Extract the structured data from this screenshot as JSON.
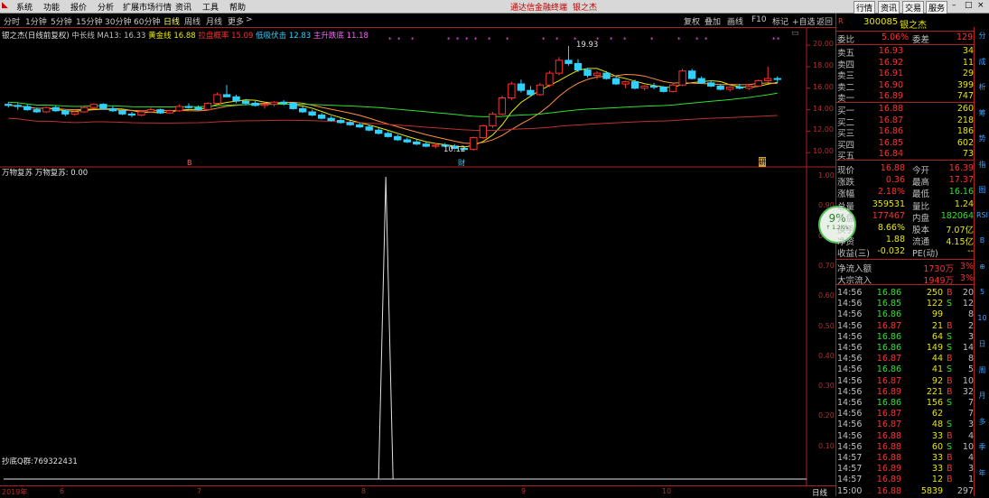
{
  "menu": [
    "系统",
    "功能",
    "报价",
    "分析",
    "扩展市场行情",
    "资讯",
    "工具",
    "帮助"
  ],
  "title_center": "通达信金融终端",
  "title_stock": "银之杰",
  "top_right_buttons": [
    "行情",
    "资讯",
    "交易",
    "服务"
  ],
  "toolbar": {
    "periods": [
      "分时",
      "1分钟",
      "5分钟",
      "15分钟",
      "30分钟",
      "60分钟",
      "日线",
      "周线",
      "月线",
      "更多",
      ">"
    ],
    "right_buttons": [
      "复权",
      "叠加",
      "画线",
      "F10",
      "标记",
      "+自选",
      "返回"
    ]
  },
  "chart_header": {
    "name": "银之杰(日线前复权)",
    "items": [
      {
        "label": "中长线",
        "color": "#c0c0c0"
      },
      {
        "label": "MA13: 16.33",
        "color": "#c0c0c0"
      },
      {
        "label": "黄金线",
        "color": "#e8e800"
      },
      {
        "label": "16.88",
        "color": "#e8e800"
      },
      {
        "label": "拉盘概率",
        "color": "#ff3030"
      },
      {
        "label": "15.09",
        "color": "#ff3030"
      },
      {
        "label": "低吸伏击",
        "color": "#30d0ff"
      },
      {
        "label": "12.83",
        "color": "#30d0ff"
      },
      {
        "label": "主升跌底",
        "color": "#ff60ff"
      },
      {
        "label": "11.18",
        "color": "#ff60ff"
      }
    ]
  },
  "chart_data": [
    {
      "type": "candlestick",
      "y_ticks": [
        "20.00",
        "18.00",
        "16.00",
        "14.00",
        "12.00",
        "10.00"
      ],
      "ylim": [
        9.6,
        20.6
      ],
      "annotations": [
        {
          "text": "19.93"
        },
        {
          "text": "10.12"
        }
      ],
      "bottom_marks": [
        "B",
        "财",
        "研"
      ],
      "candles": [
        [
          14.5,
          14.7,
          14.2,
          14.4
        ],
        [
          14.4,
          14.6,
          14.0,
          14.3
        ],
        [
          14.3,
          14.5,
          13.9,
          14.0
        ],
        [
          14.0,
          14.2,
          13.7,
          13.8
        ],
        [
          13.8,
          14.3,
          13.7,
          14.2
        ],
        [
          14.2,
          14.4,
          13.8,
          13.9
        ],
        [
          13.9,
          14.0,
          13.4,
          13.6
        ],
        [
          13.6,
          13.9,
          13.4,
          13.8
        ],
        [
          13.8,
          14.3,
          13.7,
          14.2
        ],
        [
          14.2,
          14.6,
          14.1,
          14.5
        ],
        [
          14.5,
          14.6,
          14.0,
          14.1
        ],
        [
          14.1,
          14.3,
          13.8,
          13.9
        ],
        [
          13.9,
          14.0,
          13.5,
          13.6
        ],
        [
          13.6,
          13.8,
          13.3,
          13.5
        ],
        [
          13.5,
          13.9,
          13.4,
          13.8
        ],
        [
          13.8,
          14.2,
          13.7,
          14.0
        ],
        [
          14.0,
          14.1,
          13.6,
          13.7
        ],
        [
          13.7,
          14.0,
          13.6,
          13.9
        ],
        [
          13.9,
          14.5,
          13.8,
          14.3
        ],
        [
          14.3,
          14.6,
          14.1,
          14.2
        ],
        [
          14.2,
          14.4,
          13.9,
          14.0
        ],
        [
          14.0,
          14.7,
          13.9,
          14.6
        ],
        [
          14.6,
          15.6,
          14.5,
          15.4
        ],
        [
          15.4,
          16.3,
          15.2,
          15.2
        ],
        [
          15.2,
          15.4,
          14.6,
          14.8
        ],
        [
          14.8,
          15.0,
          14.4,
          14.6
        ],
        [
          14.6,
          14.8,
          14.3,
          14.4
        ],
        [
          14.4,
          14.6,
          14.1,
          14.5
        ],
        [
          14.5,
          14.8,
          14.3,
          14.7
        ],
        [
          14.7,
          14.9,
          14.4,
          14.6
        ],
        [
          14.6,
          14.7,
          14.0,
          14.1
        ],
        [
          14.1,
          14.3,
          13.7,
          13.8
        ],
        [
          13.8,
          14.0,
          13.4,
          13.5
        ],
        [
          13.5,
          13.7,
          13.1,
          13.2
        ],
        [
          13.2,
          13.4,
          12.9,
          13.0
        ],
        [
          13.0,
          13.2,
          12.7,
          12.8
        ],
        [
          12.8,
          13.0,
          12.5,
          12.6
        ],
        [
          12.6,
          12.8,
          12.3,
          12.4
        ],
        [
          12.4,
          12.6,
          12.0,
          12.1
        ],
        [
          12.1,
          12.3,
          11.7,
          11.8
        ],
        [
          11.8,
          12.0,
          11.4,
          11.5
        ],
        [
          11.5,
          11.7,
          11.1,
          11.2
        ],
        [
          11.2,
          11.4,
          10.9,
          11.0
        ],
        [
          11.0,
          11.2,
          10.7,
          10.8
        ],
        [
          10.8,
          11.0,
          10.5,
          10.6
        ],
        [
          10.6,
          10.9,
          10.4,
          10.7
        ],
        [
          10.7,
          10.9,
          10.5,
          10.6
        ],
        [
          10.6,
          10.8,
          10.3,
          10.4
        ],
        [
          10.4,
          10.6,
          10.12,
          10.3
        ],
        [
          10.3,
          11.5,
          10.2,
          11.4
        ],
        [
          11.4,
          12.6,
          11.3,
          12.5
        ],
        [
          12.5,
          13.8,
          12.3,
          13.6
        ],
        [
          13.6,
          15.3,
          13.5,
          15.1
        ],
        [
          15.1,
          16.6,
          14.9,
          16.4
        ],
        [
          16.4,
          16.8,
          15.6,
          15.8
        ],
        [
          15.8,
          16.2,
          15.2,
          15.4
        ],
        [
          15.4,
          16.5,
          15.3,
          16.3
        ],
        [
          16.3,
          17.6,
          16.1,
          17.4
        ],
        [
          17.4,
          18.9,
          17.2,
          18.6
        ],
        [
          18.6,
          19.93,
          18.1,
          18.3
        ],
        [
          18.3,
          18.7,
          17.5,
          17.7
        ],
        [
          17.7,
          17.9,
          17.0,
          17.2
        ],
        [
          17.2,
          17.6,
          16.8,
          17.4
        ],
        [
          17.4,
          17.6,
          16.8,
          16.9
        ],
        [
          16.9,
          17.1,
          16.3,
          16.4
        ],
        [
          16.4,
          16.7,
          16.0,
          16.6
        ],
        [
          16.6,
          16.8,
          15.9,
          16.0
        ],
        [
          16.0,
          16.3,
          15.8,
          16.2
        ],
        [
          16.2,
          16.5,
          15.9,
          16.1
        ],
        [
          16.1,
          16.2,
          15.6,
          15.7
        ],
        [
          15.7,
          16.4,
          15.6,
          16.3
        ],
        [
          16.3,
          17.8,
          16.2,
          17.6
        ],
        [
          17.6,
          17.8,
          16.8,
          16.9
        ],
        [
          16.9,
          17.1,
          16.4,
          16.5
        ],
        [
          16.5,
          16.7,
          16.1,
          16.2
        ],
        [
          16.2,
          16.4,
          15.8,
          15.9
        ],
        [
          15.9,
          16.2,
          15.7,
          16.1
        ],
        [
          16.1,
          16.4,
          15.9,
          16.0
        ],
        [
          16.0,
          16.3,
          15.8,
          16.2
        ],
        [
          16.2,
          16.8,
          16.1,
          16.7
        ],
        [
          16.7,
          18.0,
          16.5,
          16.9
        ],
        [
          16.9,
          17.1,
          16.5,
          16.88
        ]
      ]
    },
    {
      "type": "line",
      "title": "万物复苏 万物复苏: 0.00",
      "y_ticks": [
        "1.00",
        "0.90",
        "0.80",
        "0.70",
        "0.60",
        "0.50",
        "0.40",
        "0.30",
        "0.20",
        "0.10"
      ],
      "ylim": [
        0,
        1.0
      ],
      "spike": {
        "at_fraction": 0.476,
        "value": 1.0
      },
      "footnote": "抄底Q群:769322431"
    }
  ],
  "x_axis": {
    "labels": [
      "2019年",
      "6",
      "7",
      "8",
      "9",
      "10"
    ],
    "tail": "日线"
  },
  "quote": {
    "code": "300085",
    "name": "银之杰",
    "r_mark": "R",
    "weibi": {
      "label": "委比",
      "value": "5.06%",
      "label2": "委差",
      "value2": "129"
    },
    "sells": [
      {
        "label": "卖五",
        "price": "16.93",
        "vol": "34"
      },
      {
        "label": "卖四",
        "price": "16.92",
        "vol": "11"
      },
      {
        "label": "卖三",
        "price": "16.91",
        "vol": "29"
      },
      {
        "label": "卖二",
        "price": "16.90",
        "vol": "399"
      },
      {
        "label": "卖一",
        "price": "16.89",
        "vol": "747"
      }
    ],
    "buys": [
      {
        "label": "买一",
        "price": "16.88",
        "vol": "260"
      },
      {
        "label": "买二",
        "price": "16.87",
        "vol": "218"
      },
      {
        "label": "买三",
        "price": "16.86",
        "vol": "186"
      },
      {
        "label": "买四",
        "price": "16.85",
        "vol": "602"
      },
      {
        "label": "买五",
        "price": "16.84",
        "vol": "73"
      }
    ],
    "stats": [
      {
        "l1": "现价",
        "v1": "16.88",
        "l2": "今开",
        "v2": "16.39"
      },
      {
        "l1": "涨跌",
        "v1": "0.36",
        "l2": "最高",
        "v2": "17.37"
      },
      {
        "l1": "涨幅",
        "v1": "2.18%",
        "l2": "最低",
        "v2": "16.16"
      },
      {
        "l1": "总量",
        "v1": "359531",
        "l2": "量比",
        "v2": "1.24"
      },
      {
        "l1": "外盘",
        "v1": "177467",
        "l2": "内盘",
        "v2": "182064"
      },
      {
        "l1": "换手",
        "v1": "8.66%",
        "l2": "股本",
        "v2": "7.07亿"
      },
      {
        "l1": "净资",
        "v1": "1.88",
        "l2": "流通",
        "v2": "4.15亿"
      },
      {
        "l1": "收益(三)",
        "v1": "-0.032",
        "l2": "PE(动)",
        "v2": "--"
      }
    ],
    "flows": [
      {
        "label": "净流入额",
        "value": "1730万",
        "pct": "3%"
      },
      {
        "label": "大宗流入",
        "value": "1949万",
        "pct": "3%"
      }
    ],
    "gauge": {
      "pct": "9%",
      "speed": "↑ 1.2K/s"
    },
    "ticks": [
      {
        "time": "14:56",
        "price": "16.86",
        "vol": "250",
        "bs": "B",
        "n": "20"
      },
      {
        "time": "14:56",
        "price": "16.85",
        "vol": "122",
        "bs": "S",
        "n": "12"
      },
      {
        "time": "14:56",
        "price": "16.86",
        "vol": "99",
        "bs": "",
        "n": "8"
      },
      {
        "time": "14:56",
        "price": "16.87",
        "vol": "21",
        "bs": "B",
        "n": "2"
      },
      {
        "time": "14:56",
        "price": "16.86",
        "vol": "64",
        "bs": "S",
        "n": "3"
      },
      {
        "time": "14:56",
        "price": "16.86",
        "vol": "149",
        "bs": "S",
        "n": "14"
      },
      {
        "time": "14:56",
        "price": "16.87",
        "vol": "44",
        "bs": "B",
        "n": "8"
      },
      {
        "time": "14:56",
        "price": "16.86",
        "vol": "41",
        "bs": "S",
        "n": "5"
      },
      {
        "time": "14:56",
        "price": "16.87",
        "vol": "92",
        "bs": "B",
        "n": "10"
      },
      {
        "time": "14:56",
        "price": "16.89",
        "vol": "221",
        "bs": "B",
        "n": "32"
      },
      {
        "time": "14:56",
        "price": "16.86",
        "vol": "156",
        "bs": "S",
        "n": "7"
      },
      {
        "time": "14:56",
        "price": "16.87",
        "vol": "62",
        "bs": "",
        "n": "7"
      },
      {
        "time": "14:56",
        "price": "16.87",
        "vol": "48",
        "bs": "S",
        "n": "3"
      },
      {
        "time": "14:56",
        "price": "16.88",
        "vol": "33",
        "bs": "B",
        "n": "4"
      },
      {
        "time": "14:56",
        "price": "16.88",
        "vol": "60",
        "bs": "S",
        "n": "10"
      },
      {
        "time": "14:57",
        "price": "16.88",
        "vol": "33",
        "bs": "B",
        "n": "4"
      },
      {
        "time": "14:57",
        "price": "16.89",
        "vol": "33",
        "bs": "B",
        "n": "3"
      },
      {
        "time": "14:57",
        "price": "16.89",
        "vol": "12",
        "bs": "B",
        "n": "1"
      },
      {
        "time": "15:00",
        "price": "16.88",
        "vol": "5839",
        "bs": "",
        "n": "297"
      }
    ]
  },
  "side_icons": [
    "分",
    "成",
    "析",
    "筹",
    "势",
    "指",
    "图",
    "RSI",
    "B",
    "⊕",
    "5",
    "10",
    "日",
    "周",
    "月",
    "多",
    "季",
    "年"
  ],
  "colors": {
    "up": "#ff3030",
    "down": "#30d0ff",
    "bg": "#000000",
    "grid": "#b02020",
    "yellow": "#e8e800",
    "green": "#30e030"
  }
}
